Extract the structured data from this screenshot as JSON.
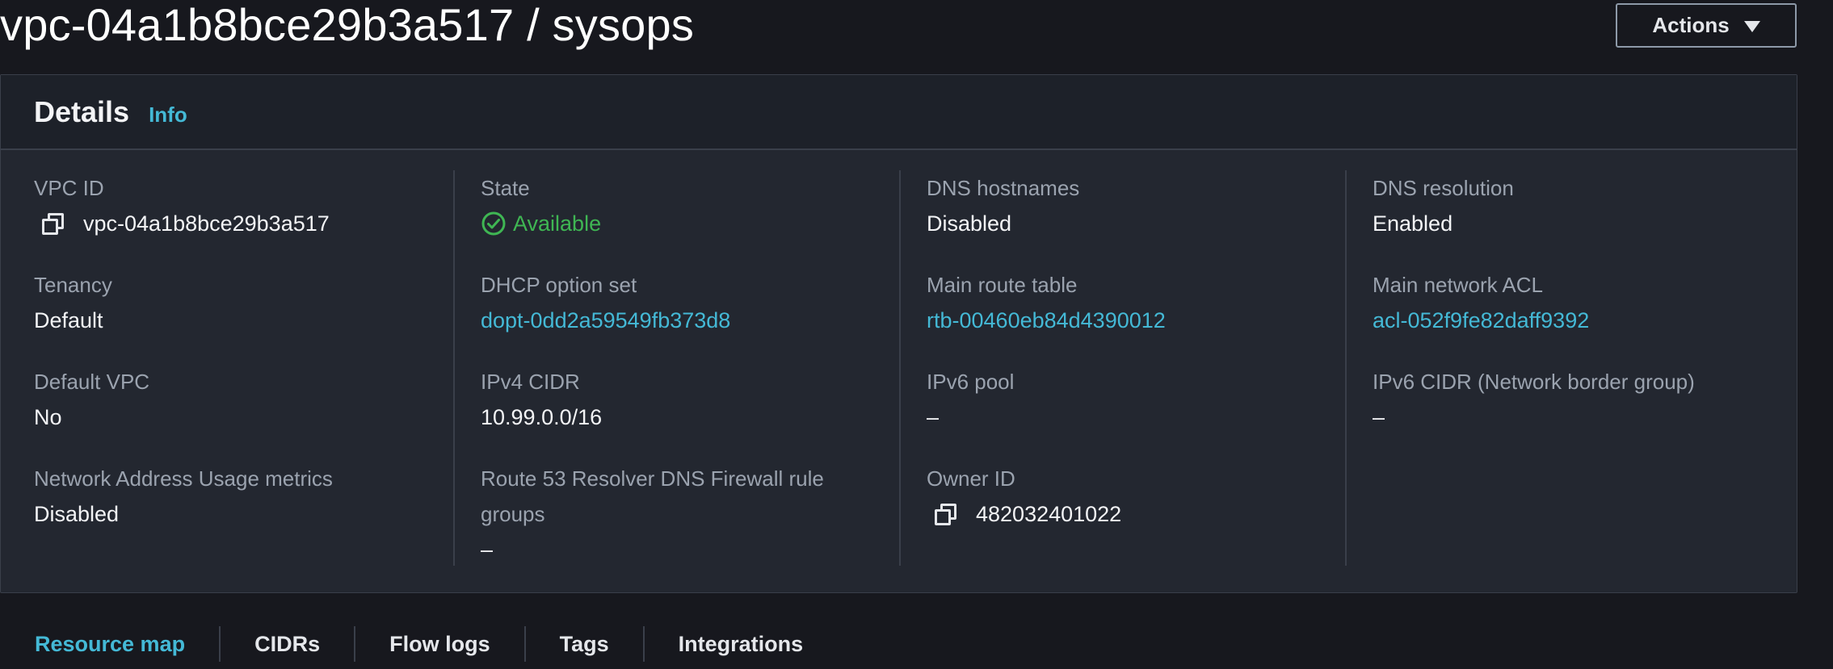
{
  "page": {
    "title": "vpc-04a1b8bce29b3a517 / sysops",
    "actions_label": "Actions"
  },
  "details": {
    "title": "Details",
    "info_label": "Info",
    "columns": [
      [
        {
          "label": "VPC ID",
          "value": "vpc-04a1b8bce29b3a517",
          "icon": "copy-icon"
        },
        {
          "label": "Tenancy",
          "value": "Default"
        },
        {
          "label": "Default VPC",
          "value": "No"
        },
        {
          "label": "Network Address Usage metrics",
          "value": "Disabled"
        }
      ],
      [
        {
          "label": "State",
          "value": "Available",
          "icon": "check-circle-icon"
        },
        {
          "label": "DHCP option set",
          "value": "dopt-0dd2a59549fb373d8"
        },
        {
          "label": "IPv4 CIDR",
          "value": "10.99.0.0/16"
        },
        {
          "label": "Route 53 Resolver DNS Firewall rule groups",
          "value": "–"
        }
      ],
      [
        {
          "label": "DNS hostnames",
          "value": "Disabled"
        },
        {
          "label": "Main route table",
          "value": "rtb-00460eb84d4390012"
        },
        {
          "label": "IPv6 pool",
          "value": "–"
        },
        {
          "label": "Owner ID",
          "value": "482032401022",
          "icon": "copy-icon"
        }
      ],
      [
        {
          "label": "DNS resolution",
          "value": "Enabled"
        },
        {
          "label": "Main network ACL",
          "value": "acl-052f9fe82daff9392"
        },
        {
          "label": "IPv6 CIDR (Network border group)",
          "value": "–"
        }
      ]
    ]
  },
  "tabs": [
    {
      "label": "Resource map",
      "active": true
    },
    {
      "label": "CIDRs"
    },
    {
      "label": "Flow logs"
    },
    {
      "label": "Tags"
    },
    {
      "label": "Integrations"
    }
  ],
  "colors": {
    "link": "#44b9d6",
    "success": "#3fb653",
    "background": "#17181e",
    "panel": "#232730"
  }
}
